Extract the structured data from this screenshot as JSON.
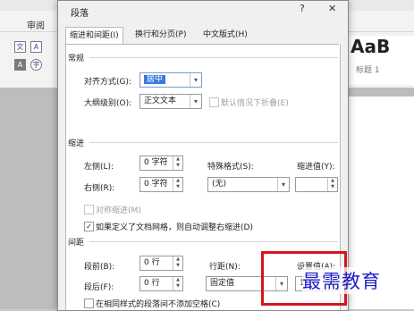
{
  "app": {
    "ribbon_tab": "审阅",
    "style_preview_text": "AaB",
    "style_name": "标题 1"
  },
  "dialog": {
    "title": "段落",
    "help_glyph": "?",
    "close_glyph": "✕",
    "tabs": [
      {
        "label": "缩进和间距(I)",
        "active": true
      },
      {
        "label": "换行和分页(P)",
        "active": false
      },
      {
        "label": "中文版式(H)",
        "active": false
      }
    ],
    "general": {
      "heading": "常规",
      "alignment_label": "对齐方式(G):",
      "alignment_value": "居中",
      "outline_label": "大纲级别(O):",
      "outline_value": "正文文本",
      "collapse_label": "默认情况下折叠(E)",
      "collapse_checked": false,
      "collapse_enabled": false
    },
    "indent": {
      "heading": "缩进",
      "left_label": "左侧(L):",
      "left_value": "0 字符",
      "right_label": "右侧(R):",
      "right_value": "0 字符",
      "special_label": "特殊格式(S):",
      "special_value": "(无)",
      "by_label": "缩进值(Y):",
      "by_value": "",
      "mirror_label": "对称缩进(M)",
      "mirror_checked": false,
      "mirror_enabled": false,
      "grid_label": "如果定义了文档网格，则自动调整右缩进(D)",
      "grid_checked": true
    },
    "spacing": {
      "heading": "间距",
      "before_label": "段前(B):",
      "before_value": "0 行",
      "after_label": "段后(F):",
      "after_value": "0 行",
      "line_label": "行距(N):",
      "line_value": "固定值",
      "at_label": "设置值(A):",
      "at_value": "1",
      "no_space_label": "在相同样式的段落间不添加空格(C)",
      "no_space_checked": false
    }
  },
  "watermark": "最需教育",
  "colors": {
    "highlight_box": "#d6141e",
    "selection": "#3b7ad8",
    "watermark": "#1f1fc8"
  }
}
